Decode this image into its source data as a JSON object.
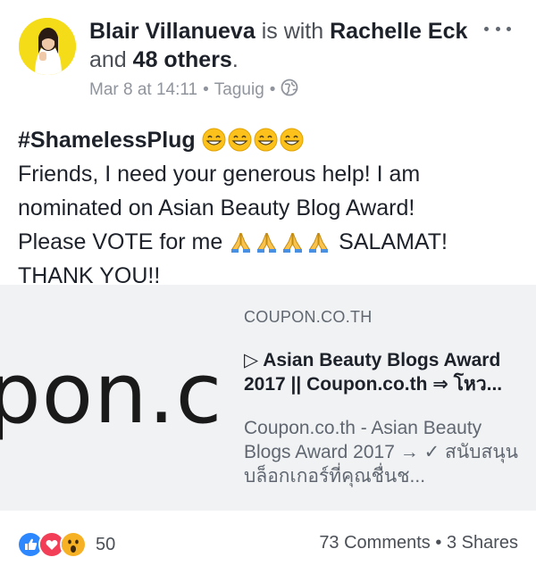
{
  "post": {
    "author": "Blair Villanueva",
    "with_text": "is with",
    "tagged": "Rachelle Eck",
    "and_text": "and",
    "others": "48 others",
    "period": ".",
    "date": "Mar 8 at 14:11",
    "location": "Taguig",
    "audience_icon": "globe-icon",
    "hashtag": "#ShamelessPlug",
    "line2": "Friends, I need your generous help! I am",
    "line3": "nominated on Asian Beauty Blog Award!",
    "line4a": "Please VOTE for me",
    "line4b": "SALAMAT!",
    "line5": "THANK YOU!!"
  },
  "link": {
    "image_text": "pon.c",
    "domain": "COUPON.CO.TH",
    "title": "▷ Asian Beauty Blogs Award 2017 || Coupon.co.th ⇒ โหว...",
    "description": "Coupon.co.th - Asian Beauty Blogs Award 2017 → ✓ สนับสนุนบล็อกเกอร์ที่คุณชื่นช..."
  },
  "footer": {
    "reaction_count": "50",
    "comments": "73 Comments",
    "shares": "3 Shares",
    "reactions": [
      "like-icon",
      "love-icon",
      "wow-icon"
    ]
  },
  "colors": {
    "like": "#2d88ff",
    "love": "#f33e58",
    "wow": "#f7b125",
    "avatar_bg": "#f5dc18",
    "card_bg": "#f1f2f4"
  }
}
